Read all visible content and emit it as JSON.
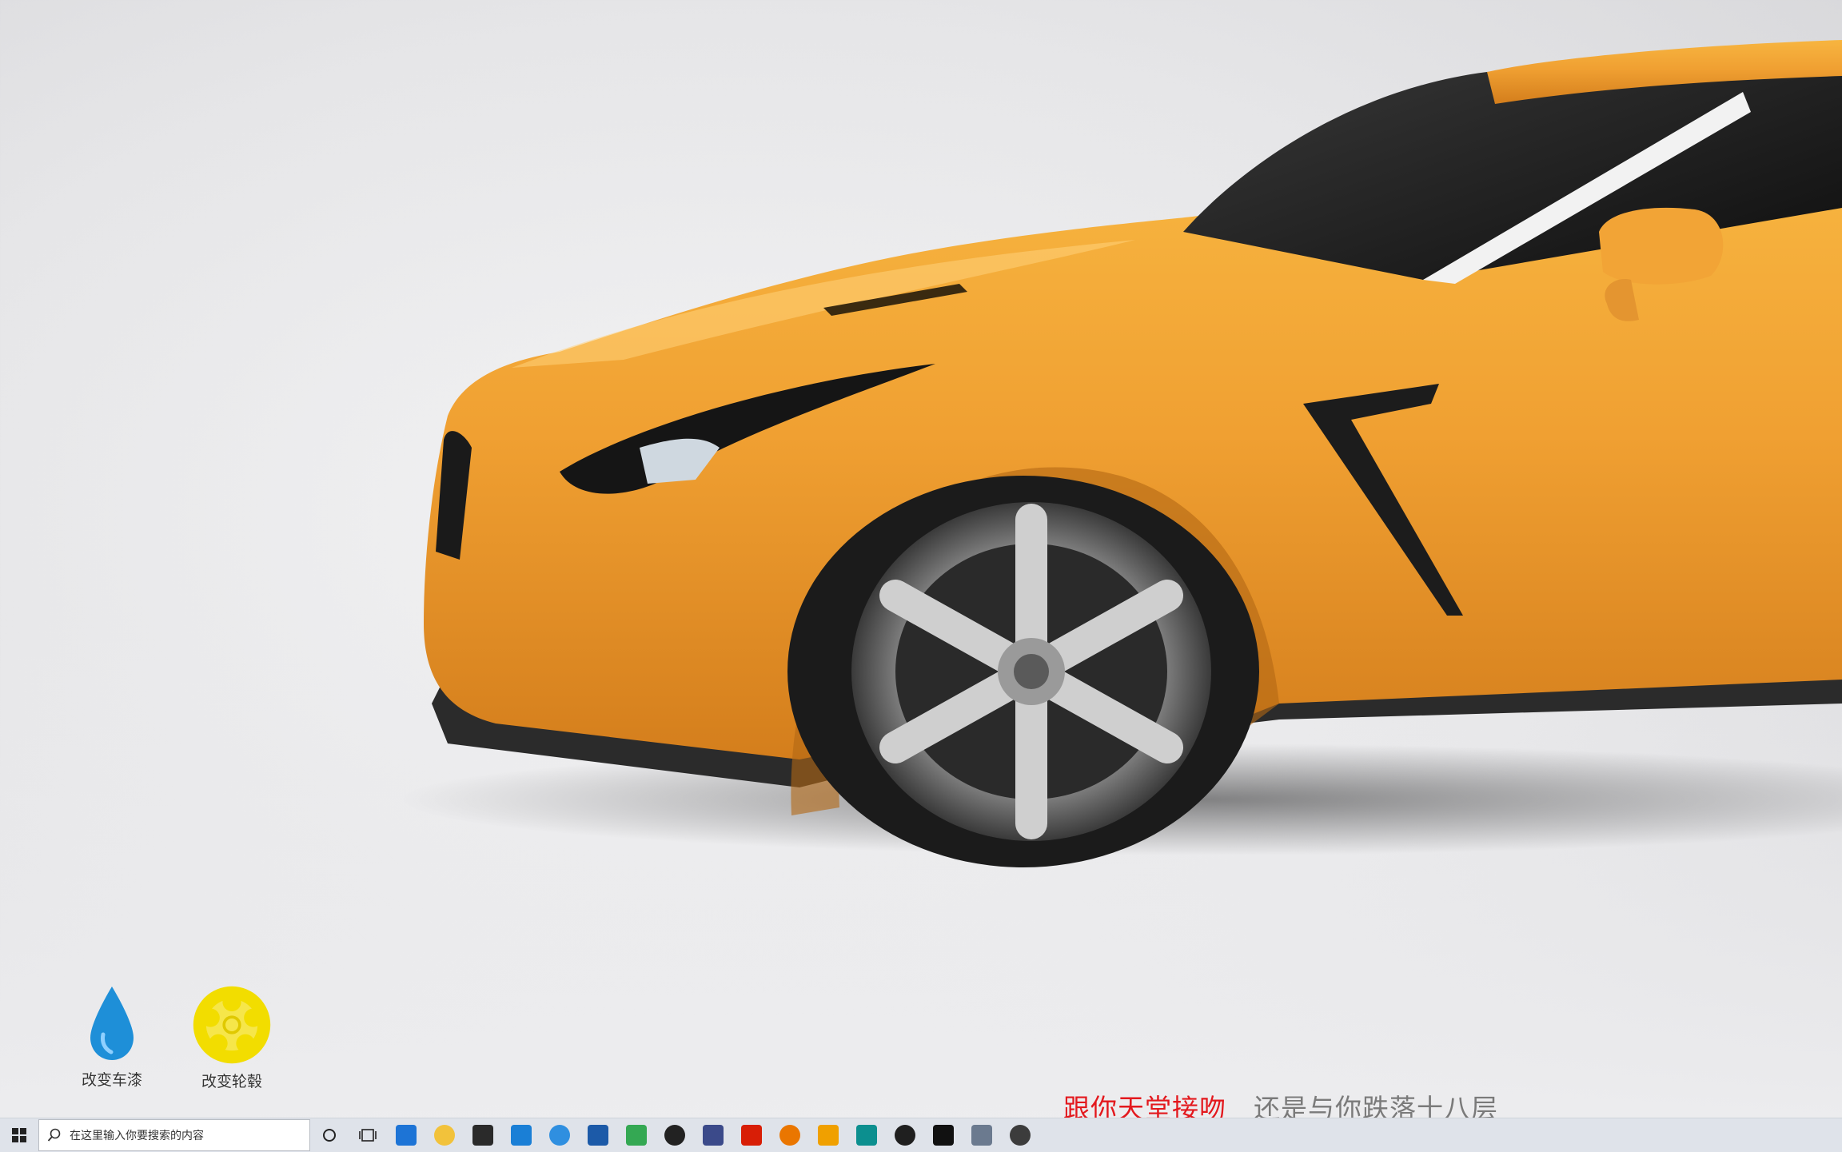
{
  "desktop_buttons": [
    {
      "label": "改变车漆",
      "icon": "water-drop-icon",
      "color": "#1e8fd8"
    },
    {
      "label": "改变轮毂",
      "icon": "wheel-rim-icon",
      "color": "#f2dd00"
    }
  ],
  "lyrics": {
    "line1": "跟你天堂接吻",
    "line2": "还是与你跌落十八层"
  },
  "taskbar": {
    "search_placeholder": "在这里输入你要搜索的内容",
    "pinned_apps": [
      {
        "name": "edge-icon",
        "color": "#1d74d6"
      },
      {
        "name": "file-explorer-icon",
        "color": "#f2c23b"
      },
      {
        "name": "store-icon",
        "color": "#2a2a2a"
      },
      {
        "name": "mail-icon",
        "color": "#1a7fd6"
      },
      {
        "name": "bird-app-icon",
        "color": "#2f8fe0"
      },
      {
        "name": "eye-app-icon",
        "color": "#1c5aa8"
      },
      {
        "name": "chrome-icon",
        "color": "#34a853"
      },
      {
        "name": "record-app-icon",
        "color": "#222222"
      },
      {
        "name": "globe-app-icon",
        "color": "#3b4a8a"
      },
      {
        "name": "netease-music-icon",
        "color": "#d81e06"
      },
      {
        "name": "blender-icon",
        "color": "#ea7600"
      },
      {
        "name": "media-player-icon",
        "color": "#f0a000"
      },
      {
        "name": "3dsmax-icon",
        "color": "#0c8f8f"
      },
      {
        "name": "davinci-icon",
        "color": "#1f1f1f"
      },
      {
        "name": "unreal-engine-icon",
        "color": "#111111"
      },
      {
        "name": "photos-app-icon",
        "color": "#6b7a8f"
      },
      {
        "name": "tool-app-icon",
        "color": "#3c3c3c"
      }
    ]
  },
  "colors": {
    "car_paint": "#f0a032",
    "accent": "#e3181d"
  }
}
